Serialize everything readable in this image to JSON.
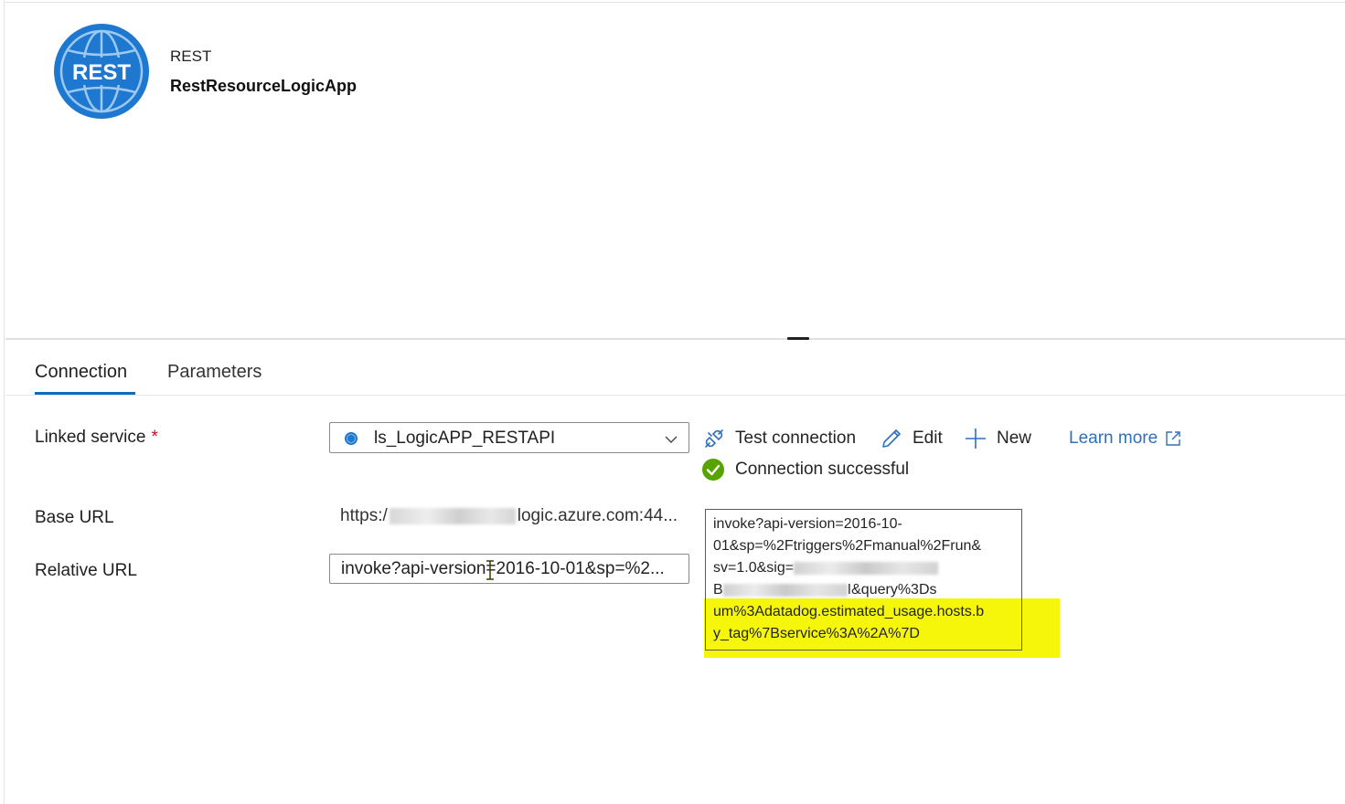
{
  "header": {
    "type_label": "REST",
    "dataset_name": "RestResourceLogicApp",
    "logo_text": "REST"
  },
  "tabs": [
    {
      "label": "Connection",
      "active": true
    },
    {
      "label": "Parameters",
      "active": false
    }
  ],
  "form": {
    "linked_service": {
      "label": "Linked service",
      "required_mark": "*",
      "value": "ls_LogicAPP_RESTAPI"
    },
    "base_url": {
      "label": "Base URL",
      "prefix": "https:/",
      "suffix": "logic.azure.com:44..."
    },
    "relative_url": {
      "label": "Relative URL",
      "value": "invoke?api-version=2016-10-01&sp=%2..."
    }
  },
  "actions": {
    "test_connection": "Test connection",
    "edit": "Edit",
    "new": "New",
    "learn_more": "Learn more"
  },
  "status": {
    "text": "Connection successful",
    "color": "#57a300"
  },
  "tooltip": {
    "line1": "invoke?api-version=2016-10-",
    "line2": "01&sp=%2Ftriggers%2Fmanual%2Frun&",
    "line3_prefix": "sv=1.0&sig=",
    "line4_prefix": "B",
    "line4_suffix": "I&query%3Ds",
    "line5": "um%3Adatadog.estimated_usage.hosts.b",
    "line6": "y_tag%7Bservice%3A%2A%7D",
    "highlight_color": "#f6f60a"
  },
  "colors": {
    "accent": "#0f6cbd",
    "logo_blue": "#1e78d0",
    "link": "#2f6fc0",
    "required": "#c50f1f"
  }
}
